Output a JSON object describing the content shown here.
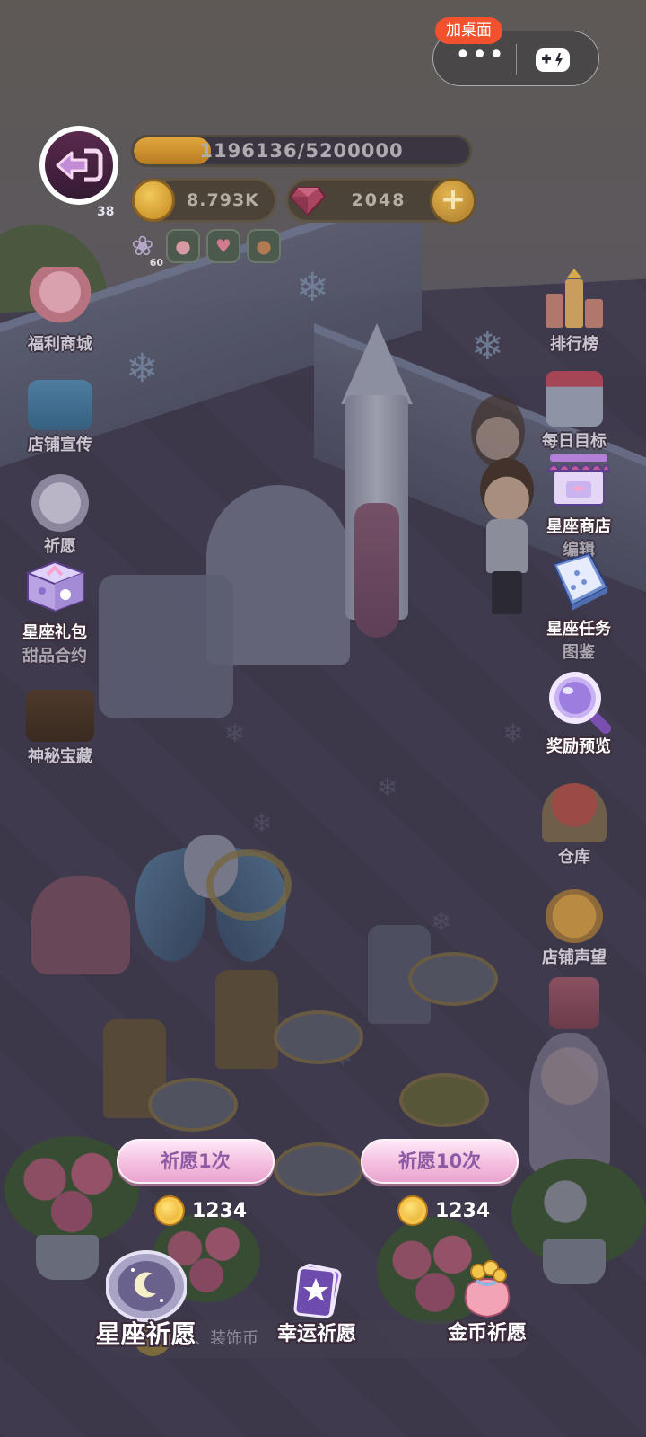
{
  "top_capsule": {
    "add_desktop_label": "加桌面",
    "more_icon": "more-dots-icon",
    "game_icon": "gamepad-icon"
  },
  "header": {
    "back_icon": "back-arrow-icon",
    "level": "38",
    "xp_text": "1196136/5200000",
    "xp_progress": 0.23,
    "coins": "8.793K",
    "gems": "2048",
    "gem_plus_icon": "plus-icon",
    "buff_badge": "60"
  },
  "left_menu": [
    {
      "label": "福利商城",
      "icon": "gift-shop-icon"
    },
    {
      "label": "店铺宣传",
      "icon": "camera-icon"
    },
    {
      "label": "祈愿",
      "icon": "wish-icon"
    },
    {
      "label": "星座礼包",
      "sub": "甜品合约",
      "icon": "gift-box-icon"
    },
    {
      "label": "神秘宝藏",
      "icon": "treasure-chest-icon"
    }
  ],
  "right_menu": [
    {
      "label": "排行榜",
      "icon": "trophy-icon"
    },
    {
      "label": "每日目标",
      "icon": "calendar-icon"
    },
    {
      "label": "星座商店",
      "sub": "编辑",
      "icon": "shop-stall-icon"
    },
    {
      "label": "星座任务",
      "sub": "图鉴",
      "icon": "task-book-icon"
    },
    {
      "label": "奖励预览",
      "icon": "magnifier-icon"
    },
    {
      "label": "仓库",
      "icon": "warehouse-icon"
    },
    {
      "label": "店铺声望",
      "icon": "reputation-icon"
    }
  ],
  "wish_panel": {
    "wish_once": "祈愿1次",
    "wish_ten": "祈愿10次",
    "cost_once": "1234",
    "cost_ten": "1234"
  },
  "tabs": [
    {
      "label": "星座祈愿",
      "icon": "constellation-orb-icon"
    },
    {
      "label": "幸运祈愿",
      "icon": "star-book-icon"
    },
    {
      "label": "金币祈愿",
      "icon": "coin-bag-icon"
    }
  ],
  "chat": {
    "text": "积、装饰币"
  },
  "colors": {
    "accent_red": "#f2512d",
    "wish_button_text": "#8b5aa3",
    "wish_button_pink": "#f4bfdf"
  }
}
